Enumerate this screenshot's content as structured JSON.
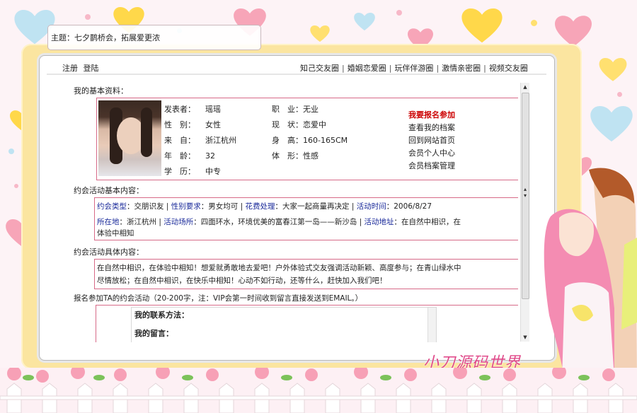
{
  "topic_bar": {
    "text": "主题：七夕鹊桥会，拓展爱更浓"
  },
  "nav": {
    "left": [
      "注册",
      "登陆"
    ],
    "right": [
      "知己交友圈",
      "婚姻恋爱圈",
      "玩伴伴游圈",
      "激情亲密圈",
      "视频交友圈"
    ],
    "sep": "|"
  },
  "basic_info": {
    "title": "我的基本资料：",
    "rows": [
      {
        "label": "发表者：",
        "value": "瑶瑶",
        "label2": "职　业：",
        "value2": "无业"
      },
      {
        "label": "性　别：",
        "value": "女性",
        "label2": "现　状：",
        "value2": "恋爱中"
      },
      {
        "label": "来　自：",
        "value": "浙江杭州",
        "label2": "身　高：",
        "value2": "160-165CM"
      },
      {
        "label": "年　龄：",
        "value": "32",
        "label2": "体　形：",
        "value2": "性感"
      },
      {
        "label": "学　历：",
        "value": "中专",
        "label2": "",
        "value2": ""
      }
    ],
    "links": [
      "我要报名参加",
      "查看我的档案",
      "回到网站首页",
      "会员个人中心",
      "会员档案管理"
    ]
  },
  "activity_basic": {
    "title": "约会活动基本内容：",
    "line1": {
      "k1": "约会类型",
      "v1": "：交朋识友",
      "s1": "|",
      "k2": "性别要求",
      "v2": "：男女均可",
      "s2": "|",
      "k3": "花费处理",
      "v3": "：大家一起商量再决定",
      "s3": "|",
      "k4": "活动时间",
      "v4": "：2006/8/27"
    },
    "line2": {
      "k1": "所在地",
      "v1": "：浙江杭州",
      "s1": "|",
      "k2": "活动场所",
      "v2": "：四面环水，环境优美的富春江第一岛——新沙岛",
      "s2": "|",
      "k3": "活动地址",
      "v3": "：在自然中相识，在"
    },
    "line3": "体验中相知"
  },
  "activity_detail": {
    "title": "约会活动具体内容：",
    "line1": "在自然中相识，在体验中相知！想爱就勇敢地去爱吧！户外体验式交友强调活动新颖、高度参与；在青山绿水中",
    "line2": "尽情放松；在自然中相识，在快乐中相知！心动不如行动，还等什么，赶快加入我们吧！"
  },
  "signup": {
    "title": "报名参加TA的约会活动（20-200字，注：VIP会第一时间收到留言直接发送到EMAIL。）",
    "contact_label": "我的联系方法：",
    "message_label": "我的留言："
  },
  "watermark": "小刀源码世界",
  "colors": {
    "accent_red": "#cc0000",
    "keyword_blue": "#1a2a9a",
    "box_border": "#d76a88",
    "frame_yellow": "#fbe5a0"
  }
}
